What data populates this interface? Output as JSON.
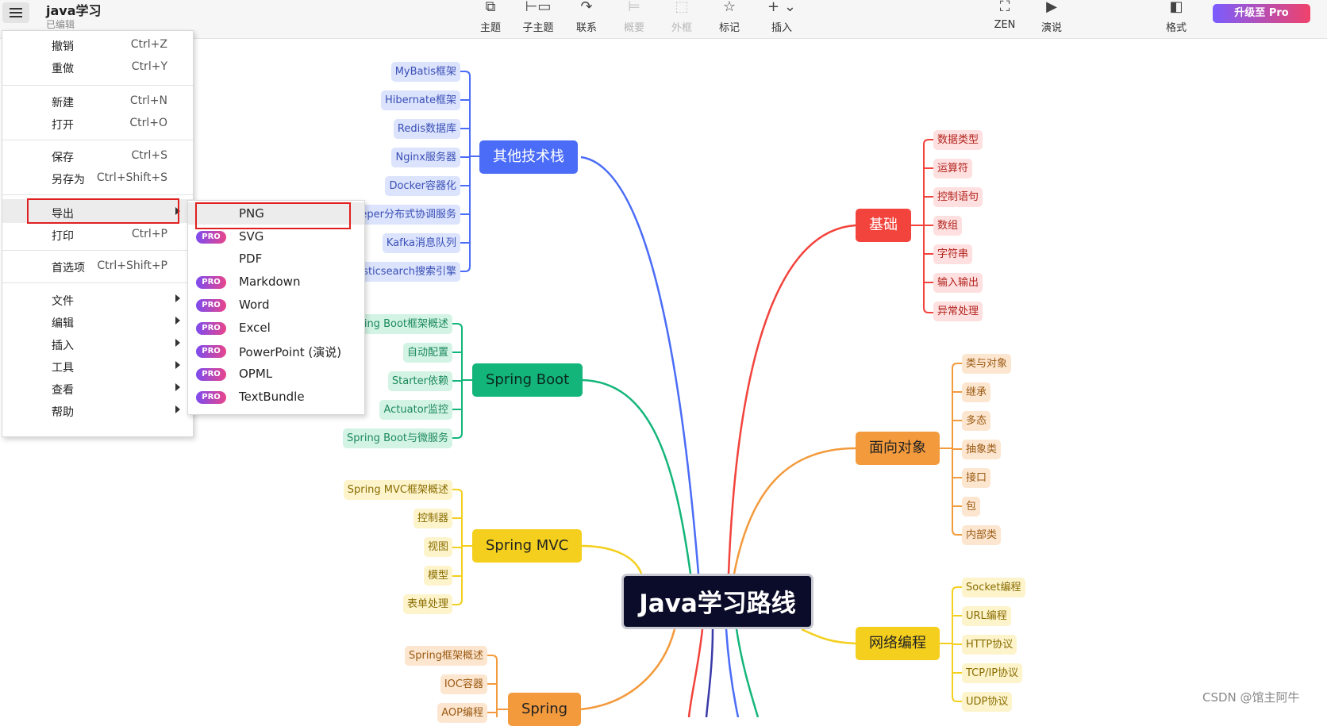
{
  "app": {
    "doc_title": "java学习",
    "doc_status": "已编辑",
    "watermark": "CSDN @馆主阿牛"
  },
  "toolbar": {
    "items": [
      {
        "label": "主题",
        "icon": "topic-icon"
      },
      {
        "label": "子主题",
        "icon": "subtopic-icon"
      },
      {
        "label": "联系",
        "icon": "relationship-icon"
      },
      {
        "label": "概要",
        "icon": "summary-icon"
      },
      {
        "label": "外框",
        "icon": "boundary-icon"
      },
      {
        "label": "标记",
        "icon": "star-icon"
      },
      {
        "label": "插入",
        "icon": "plus-icon"
      },
      {
        "label": "ZEN",
        "icon": "zen-icon"
      },
      {
        "label": "演说",
        "icon": "pitch-icon"
      },
      {
        "label": "格式",
        "icon": "format-icon"
      }
    ],
    "upgrade_label": "升级至 Pro"
  },
  "menu": {
    "items": [
      {
        "label": "撤销",
        "shortcut": "Ctrl+Z"
      },
      {
        "label": "重做",
        "shortcut": "Ctrl+Y"
      },
      {
        "label": "新建",
        "shortcut": "Ctrl+N"
      },
      {
        "label": "打开",
        "shortcut": "Ctrl+O"
      },
      {
        "label": "保存",
        "shortcut": "Ctrl+S"
      },
      {
        "label": "另存为",
        "shortcut": "Ctrl+Shift+S"
      },
      {
        "label": "导出",
        "shortcut": ""
      },
      {
        "label": "打印",
        "shortcut": "Ctrl+P"
      },
      {
        "label": "首选项",
        "shortcut": "Ctrl+Shift+P"
      },
      {
        "label": "文件",
        "shortcut": ""
      },
      {
        "label": "编辑",
        "shortcut": ""
      },
      {
        "label": "插入",
        "shortcut": ""
      },
      {
        "label": "工具",
        "shortcut": ""
      },
      {
        "label": "查看",
        "shortcut": ""
      },
      {
        "label": "帮助",
        "shortcut": ""
      }
    ]
  },
  "export_menu": {
    "badge": "PRO",
    "items": [
      {
        "label": "PNG",
        "pro": false
      },
      {
        "label": "SVG",
        "pro": true
      },
      {
        "label": "PDF",
        "pro": false
      },
      {
        "label": "Markdown",
        "pro": true
      },
      {
        "label": "Word",
        "pro": true
      },
      {
        "label": "Excel",
        "pro": true
      },
      {
        "label": "PowerPoint (演说)",
        "pro": true
      },
      {
        "label": "OPML",
        "pro": true
      },
      {
        "label": "TextBundle",
        "pro": true
      }
    ]
  },
  "mindmap": {
    "central": "Java学习路线",
    "colors": {
      "blue": "#4a6cf7",
      "green": "#13b57a",
      "yellow": "#f4cf1d",
      "orange": "#f39a3c",
      "red": "#f2433c",
      "navy": "#3a3aa8"
    },
    "branches": [
      {
        "label": "其他技术栈",
        "children": [
          "MyBatis框架",
          "Hibernate框架",
          "Redis数据库",
          "Nginx服务器",
          "Docker容器化",
          "ZooKeeper分布式协调服务",
          "Kafka消息队列",
          "Elasticsearch搜索引擎"
        ]
      },
      {
        "label": "Spring Boot",
        "children": [
          "Spring Boot框架概述",
          "自动配置",
          "Starter依赖",
          "Actuator监控",
          "Spring Boot与微服务"
        ]
      },
      {
        "label": "Spring MVC",
        "children": [
          "Spring MVC框架概述",
          "控制器",
          "视图",
          "模型",
          "表单处理"
        ]
      },
      {
        "label": "Spring",
        "children": [
          "Spring框架概述",
          "IOC容器",
          "AOP编程"
        ]
      },
      {
        "label": "基础",
        "children": [
          "数据类型",
          "运算符",
          "控制语句",
          "数组",
          "字符串",
          "输入输出",
          "异常处理"
        ]
      },
      {
        "label": "面向对象",
        "children": [
          "类与对象",
          "继承",
          "多态",
          "抽象类",
          "接口",
          "包",
          "内部类"
        ]
      },
      {
        "label": "网络编程",
        "children": [
          "Socket编程",
          "URL编程",
          "HTTP协议",
          "TCP/IP协议",
          "UDP协议"
        ]
      }
    ]
  }
}
